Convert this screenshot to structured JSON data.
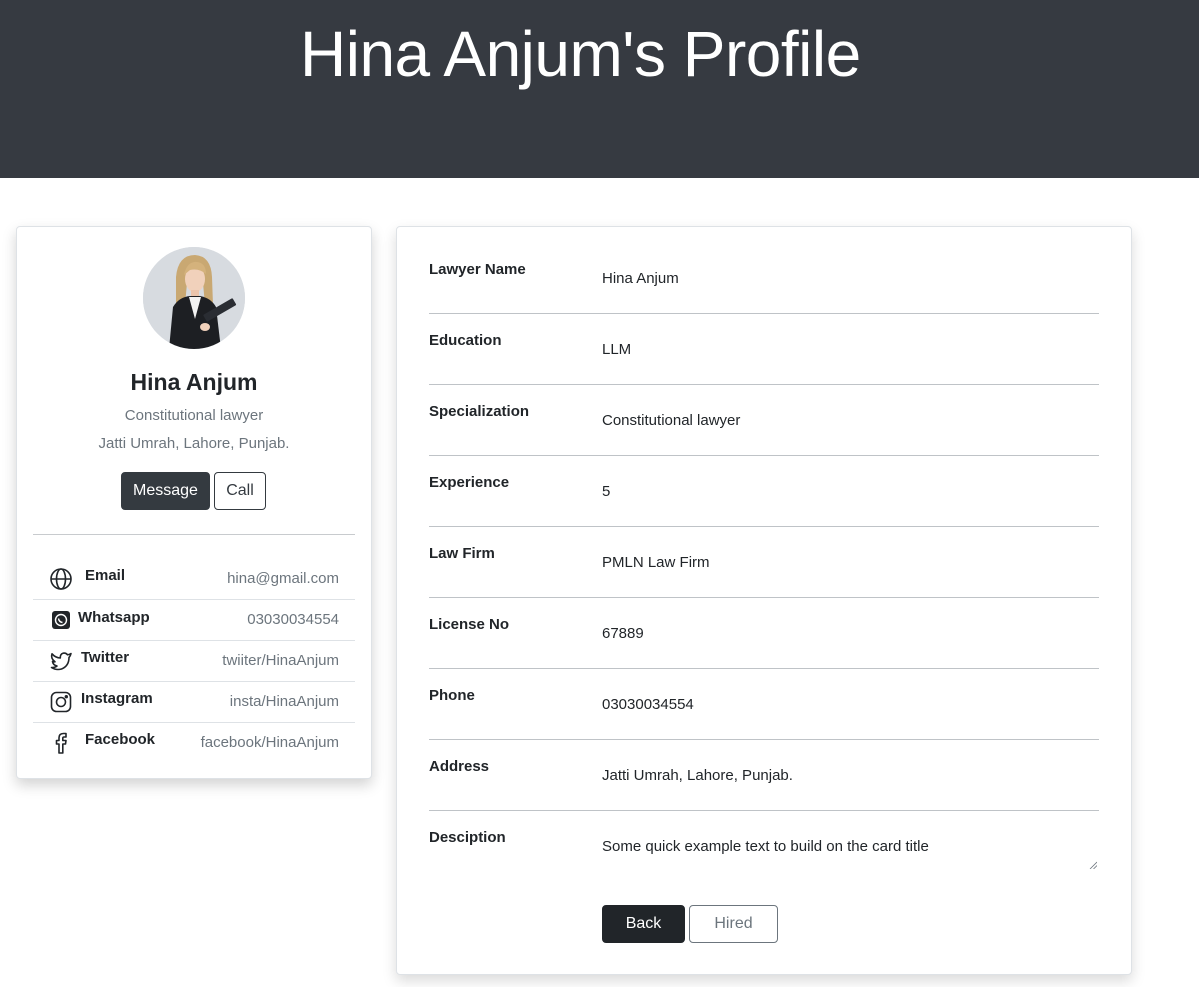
{
  "header": {
    "name": "Hina Anjum",
    "suffix": "'s Profile"
  },
  "profile": {
    "name": "Hina Anjum",
    "title": "Constitutional lawyer",
    "location": "Jatti Umrah, Lahore, Punjab.",
    "message_label": "Message",
    "call_label": "Call",
    "social": [
      {
        "icon": "globe-icon",
        "label": "Email",
        "value": "hina@gmail.com"
      },
      {
        "icon": "whatsapp-icon",
        "label": "Whatsapp",
        "value": "03030034554"
      },
      {
        "icon": "twitter-icon",
        "label": "Twitter",
        "value": "twiiter/HinaAnjum"
      },
      {
        "icon": "instagram-icon",
        "label": "Instagram",
        "value": "insta/HinaAnjum"
      },
      {
        "icon": "facebook-icon",
        "label": "Facebook",
        "value": "facebook/HinaAnjum"
      }
    ]
  },
  "details": [
    {
      "label": "Lawyer Name",
      "value": "Hina Anjum"
    },
    {
      "label": "Education",
      "value": "LLM"
    },
    {
      "label": "Specialization",
      "value": "Constitutional lawyer"
    },
    {
      "label": "Experience",
      "value": "5"
    },
    {
      "label": "Law Firm",
      "value": "PMLN Law Firm"
    },
    {
      "label": "License No",
      "value": "67889"
    },
    {
      "label": "Phone",
      "value": "03030034554"
    },
    {
      "label": "Address",
      "value": "Jatti Umrah, Lahore, Punjab."
    }
  ],
  "description": {
    "label": "Desciption",
    "value": "Some quick example text to build on the card title"
  },
  "actions": {
    "back_label": "Back",
    "hired_label": "Hired"
  },
  "colors": {
    "header_bg": "#363a41",
    "dark_button": "#212529"
  }
}
